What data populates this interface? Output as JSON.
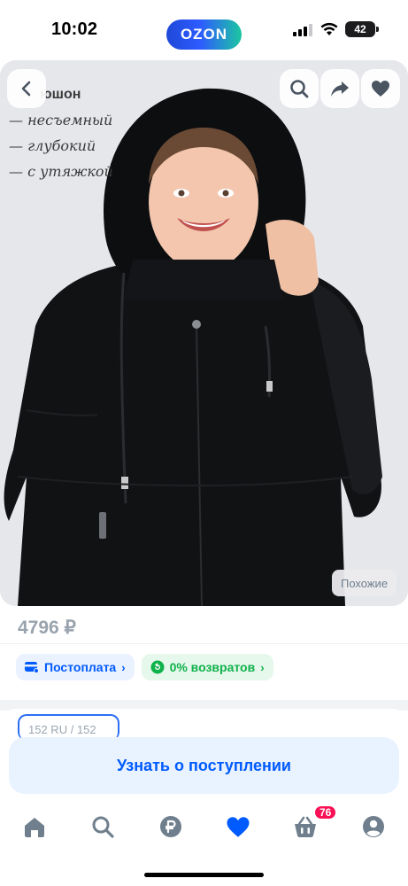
{
  "status_bar": {
    "time": "10:02",
    "center_logo": "OZON",
    "battery_level": "42",
    "icons": [
      "cellular-signal-icon",
      "wifi-icon",
      "battery-icon"
    ]
  },
  "product_image": {
    "caption_title": "юшон",
    "caption_lines": [
      "— несъемный",
      "— глубокий",
      "— с утяжкой"
    ],
    "top_buttons": [
      "back-icon",
      "search-icon",
      "share-icon",
      "heart-icon"
    ],
    "similar_label": "Похожие"
  },
  "product": {
    "price": "4796 ₽"
  },
  "chips": {
    "postpay_label": "Постоплата",
    "returns_label": "0% возвратов"
  },
  "size_selector": {
    "partial_label": "152 RU / 152"
  },
  "notify_button": {
    "label": "Узнать о поступлении"
  },
  "tab_bar": {
    "items": [
      "home-icon",
      "search-icon",
      "ruble-icon",
      "favorites-heart-icon",
      "cart-icon",
      "profile-icon"
    ],
    "cart_badge": "76",
    "active_item": "favorites-heart-icon"
  },
  "colors": {
    "brand_blue": "#005bff",
    "active_heart": "#005bff",
    "badge_pink": "#f91155",
    "returns_green": "#10b24b"
  }
}
